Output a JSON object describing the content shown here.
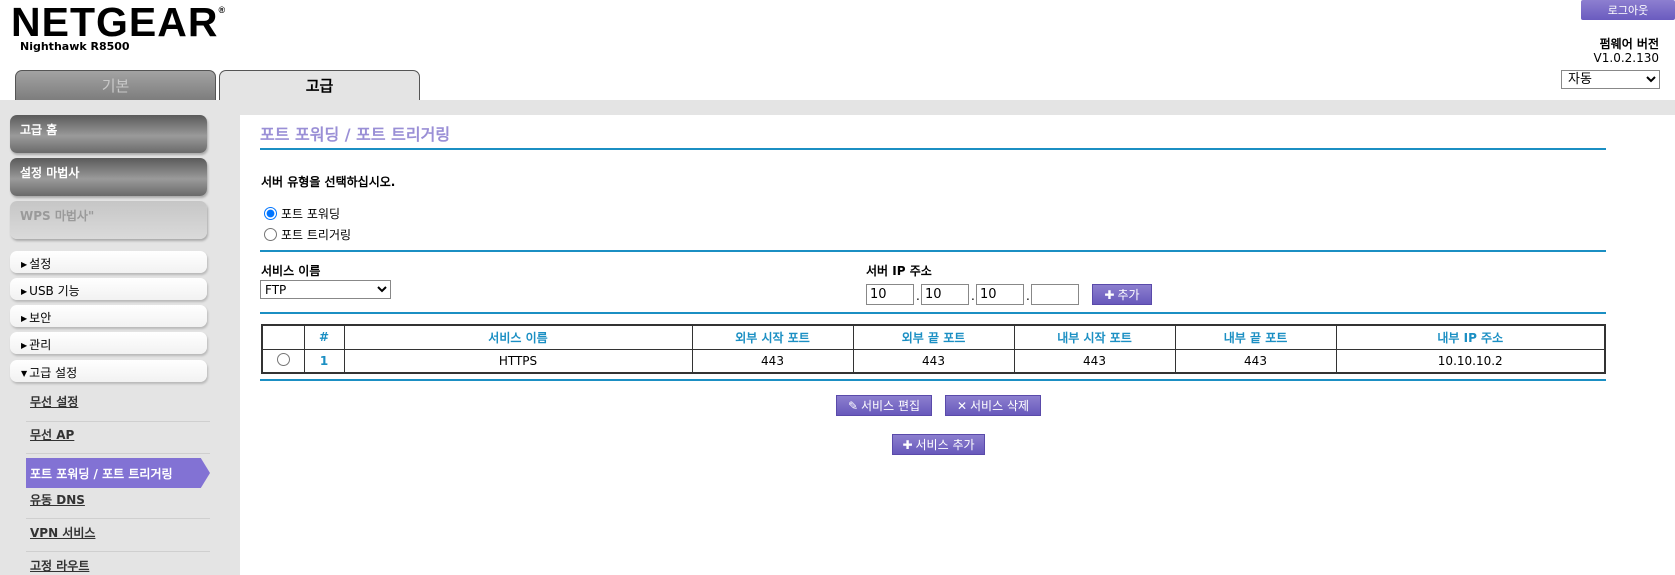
{
  "header": {
    "logo": "NETGEAR",
    "logo_mark": "®",
    "model": "Nighthawk R8500",
    "logout_label": "로그아웃",
    "firmware_label": "펌웨어 버전",
    "firmware_version": "V1.0.2.130",
    "language_selected": "자동"
  },
  "tabs": [
    {
      "label": "기본",
      "active": false
    },
    {
      "label": "고급",
      "active": true
    }
  ],
  "sidebar": {
    "big_items": [
      {
        "label": "고급 홈"
      },
      {
        "label": "설정 마법사"
      },
      {
        "label": "WPS 마법사\""
      }
    ],
    "menu_items": [
      {
        "label": "설정",
        "arrow": "▶"
      },
      {
        "label": "USB 기능",
        "arrow": "▶"
      },
      {
        "label": "보안",
        "arrow": "▶"
      },
      {
        "label": "관리",
        "arrow": "▶"
      },
      {
        "label": "고급 설정",
        "arrow": "▼"
      }
    ],
    "sub_items": [
      {
        "label": "무선 설정"
      },
      {
        "label": "무선 AP"
      },
      {
        "label": "포트 포워딩 / 포트 트리거링",
        "active": true
      },
      {
        "label": "유동 DNS"
      },
      {
        "label": "VPN 서비스"
      },
      {
        "label": "고정 라우트"
      }
    ]
  },
  "main": {
    "title": "포트 포워딩 / 포트 트리거링",
    "server_type_prompt": "서버 유형을 선택하십시오.",
    "radio_forwarding": "포트 포워딩",
    "radio_triggering": "포트 트리거링",
    "selected_mode": "포트 포워딩",
    "service_name_label": "서비스 이름",
    "service_name_selected": "FTP",
    "server_ip_label": "서버 IP 주소",
    "ip_octets": [
      "10",
      "10",
      "10",
      ""
    ],
    "ip_separator": ".",
    "add_button": "추가",
    "table": {
      "headers": [
        "",
        "#",
        "서비스 이름",
        "외부 시작 포트",
        "외부 끝 포트",
        "내부 시작 포트",
        "내부 끝 포트",
        "내부 IP 주소"
      ],
      "rows": [
        {
          "num": "1",
          "service": "HTTPS",
          "ext_start": "443",
          "ext_end": "443",
          "int_start": "443",
          "int_end": "443",
          "ip": "10.10.10.2"
        }
      ]
    },
    "edit_button": "서비스 편집",
    "delete_button": "서비스 삭제",
    "add_service_button": "서비스 추가"
  },
  "colors": {
    "accent_blue": "#1b8fc3",
    "purple": "#7a6bcb",
    "title_lavender": "#9a8fd6",
    "active_nav": "#8272d4"
  }
}
